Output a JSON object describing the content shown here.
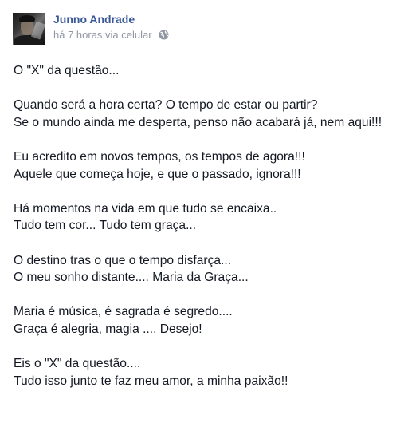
{
  "post": {
    "author_name": "Junno Andrade",
    "timestamp": "há 7 horas via celular",
    "privacy_icon": "globe-icon",
    "stanzas": [
      [
        "O \"X\" da questão..."
      ],
      [
        "Quando será a hora certa? O tempo de estar ou partir?",
        "Se o mundo ainda me desperta, penso não acabará já, nem aqui!!!"
      ],
      [
        "Eu acredito em novos tempos, os tempos de agora!!!",
        "Aquele que começa hoje, e que o passado, ignora!!!"
      ],
      [
        "Há momentos na vida em que tudo se encaixa..",
        "Tudo tem cor... Tudo tem graça..."
      ],
      [
        "O destino tras o que o tempo disfarça...",
        "O meu sonho distante.... Maria da Graça..."
      ],
      [
        "Maria é música, é sagrada é segredo....",
        "Graça é alegria, magia .... Desejo!"
      ],
      [
        "Eis o \"X\" da questão....",
        "Tudo isso junto te faz meu amor, a minha paixão!!"
      ]
    ]
  }
}
